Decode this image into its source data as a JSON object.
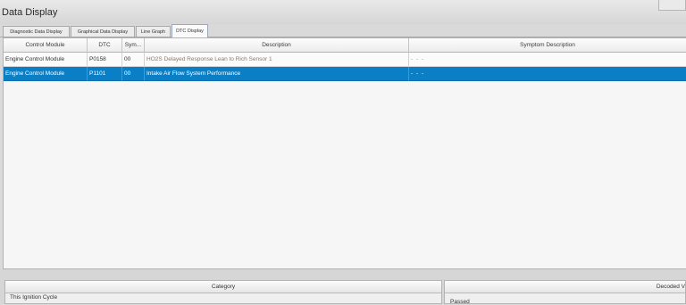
{
  "window": {
    "title": "Data Display"
  },
  "tabs": [
    {
      "label": "Diagnostic Data Display"
    },
    {
      "label": "Graphical Data Display"
    },
    {
      "label": "Line Graph"
    },
    {
      "label": "DTC Display",
      "active": true
    }
  ],
  "dtc_table": {
    "headers": {
      "module": "Control Module",
      "dtc": "DTC",
      "symptom": "Sym...",
      "description": "Description",
      "symptom_description": "Symptom Description"
    },
    "rows": [
      {
        "module": "Engine Control Module",
        "dtc": "P0158",
        "symptom": "00",
        "description": "HO2S Delayed Response Lean to Rich Sensor 1",
        "symptom_description": "- - -",
        "selected": false
      },
      {
        "module": "Engine Control Module",
        "dtc": "P1101",
        "symptom": "00",
        "description": "Intake Air Flow System Performance",
        "symptom_description": "- - -",
        "selected": true
      }
    ]
  },
  "status_panel": {
    "category_header": "Category",
    "category_value": "This Ignition Cycle",
    "decoded_header": "Decoded V",
    "decoded_value": "Passed"
  },
  "colors": {
    "selection": "#0a7fc6",
    "window_bg": "#dadada"
  }
}
